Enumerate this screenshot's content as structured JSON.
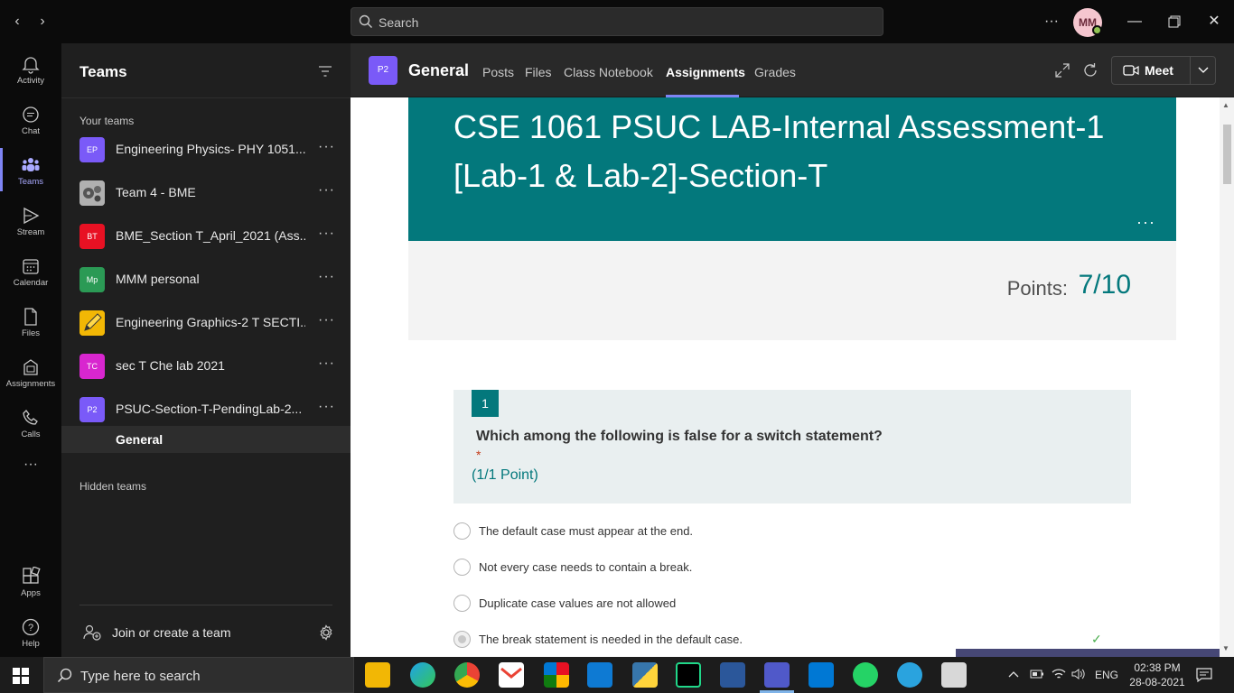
{
  "titlebar": {
    "search_placeholder": "Search",
    "more": "···",
    "avatar_initials": "MM"
  },
  "rail": {
    "items": [
      {
        "label": "Activity"
      },
      {
        "label": "Chat"
      },
      {
        "label": "Teams"
      },
      {
        "label": "Stream"
      },
      {
        "label": "Calendar"
      },
      {
        "label": "Files"
      },
      {
        "label": "Assignments"
      },
      {
        "label": "Calls"
      },
      {
        "label": "Apps"
      },
      {
        "label": "Help"
      }
    ],
    "more": "···"
  },
  "teams_panel": {
    "title": "Teams",
    "your_teams_label": "Your teams",
    "hidden_teams_label": "Hidden teams",
    "join_label": "Join or create a team",
    "teams": [
      {
        "badge": "EP",
        "name": "Engineering Physics- PHY 1051...",
        "color": "#7a5af8"
      },
      {
        "badge": "",
        "name": "Team 4 - BME",
        "color": "#9a9a9a"
      },
      {
        "badge": "BT",
        "name": "BME_Section T_April_2021 (Ass...",
        "color": "#e81123"
      },
      {
        "badge": "Mp",
        "name": "MMM personal",
        "color": "#2b9a55"
      },
      {
        "badge": "",
        "name": "Engineering Graphics-2 T SECTI...",
        "color": "#f2b705"
      },
      {
        "badge": "TC",
        "name": "sec T Che lab 2021",
        "color": "#d826cf"
      },
      {
        "badge": "P2",
        "name": "PSUC-Section-T-PendingLab-2...",
        "color": "#7a5af8"
      }
    ],
    "active_channel": "General",
    "more": "···"
  },
  "channel": {
    "badge": "P2",
    "title": "General",
    "tabs": [
      "Posts",
      "Files",
      "Class Notebook",
      "Assignments",
      "Grades"
    ],
    "active_tab": "Assignments",
    "meet_label": "Meet"
  },
  "form": {
    "title": "CSE 1061 PSUC LAB-Internal Assessment-1 [Lab-1 & Lab-2]-Section-T",
    "more": "···",
    "points_label": "Points:",
    "points_value": "7/10",
    "question": {
      "number": "1",
      "text": "Which among the following is false for a switch statement?",
      "required_mark": "*",
      "points": "(1/1 Point)",
      "options": [
        {
          "text": "The default case must appear at the end.",
          "selected": false
        },
        {
          "text": "Not every case needs to contain a break.",
          "selected": false
        },
        {
          "text": "Duplicate case values are not allowed",
          "selected": false
        },
        {
          "text": "The break statement is needed in the default case.",
          "selected": true
        }
      ]
    }
  },
  "taskbar": {
    "search_placeholder": "Type here to search",
    "language": "ENG",
    "time": "02:38 PM",
    "date": "28-08-2021"
  },
  "colors": {
    "accent": "#7f85f5",
    "form_teal": "#03787c"
  }
}
